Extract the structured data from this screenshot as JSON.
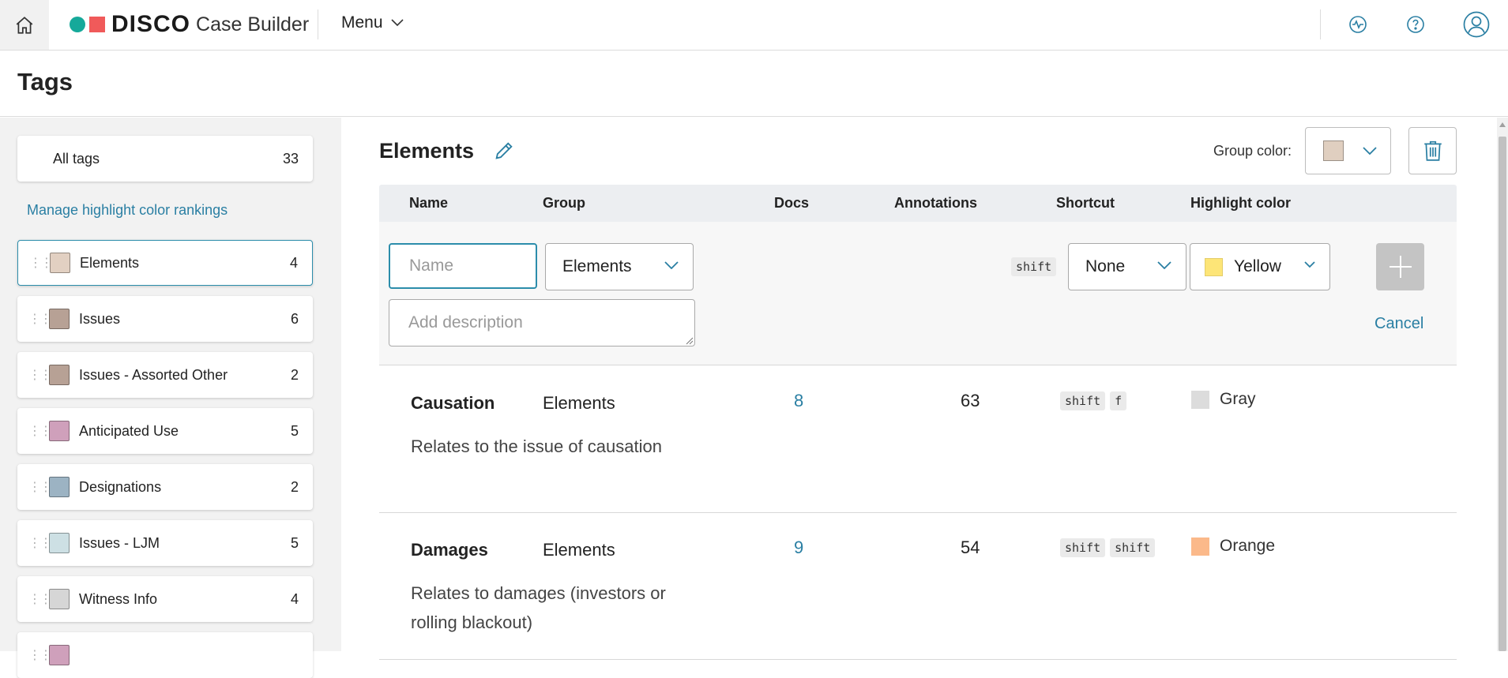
{
  "nav": {
    "brand": "DISCO",
    "product": "Case Builder",
    "menu_label": "Menu"
  },
  "page": {
    "title": "Tags"
  },
  "sidebar": {
    "all_tags": {
      "label": "All tags",
      "count": "33"
    },
    "manage_link": "Manage highlight color rankings",
    "groups": [
      {
        "label": "Elements",
        "count": "4",
        "color": "#e2d0c2"
      },
      {
        "label": "Issues",
        "count": "6",
        "color": "#b7a195"
      },
      {
        "label": "Issues - Assorted Other",
        "count": "2",
        "color": "#b7a195"
      },
      {
        "label": "Anticipated Use",
        "count": "5",
        "color": "#cfa0bb"
      },
      {
        "label": "Designations",
        "count": "2",
        "color": "#9cb3c3"
      },
      {
        "label": "Issues - LJM",
        "count": "5",
        "color": "#cde0e4"
      },
      {
        "label": "Witness Info",
        "count": "4",
        "color": "#d6d6d6"
      }
    ]
  },
  "main": {
    "group_title": "Elements",
    "group_color_label": "Group color:",
    "group_color": "#e0cfc0",
    "columns": {
      "name": "Name",
      "group": "Group",
      "docs": "Docs",
      "annotations": "Annotations",
      "shortcut": "Shortcut",
      "highlight": "Highlight color"
    },
    "new_tag": {
      "name_placeholder": "Name",
      "group_value": "Elements",
      "description_placeholder": "Add description",
      "shortcut_modifier": "shift",
      "shortcut_value": "None",
      "highlight_value": "Yellow",
      "cancel_label": "Cancel"
    },
    "rows": [
      {
        "name": "Causation",
        "group": "Elements",
        "docs": "8",
        "annotations": "63",
        "keys": [
          "shift",
          "f"
        ],
        "highlight": "Gray",
        "highlight_color": "#dcdcdc",
        "description": "Relates to the issue of causation"
      },
      {
        "name": "Damages",
        "group": "Elements",
        "docs": "9",
        "annotations": "54",
        "keys": [
          "shift",
          "shift"
        ],
        "highlight": "Orange",
        "highlight_color": "#fbb98a",
        "description": "Relates to damages (investors or rolling blackout)"
      }
    ]
  }
}
